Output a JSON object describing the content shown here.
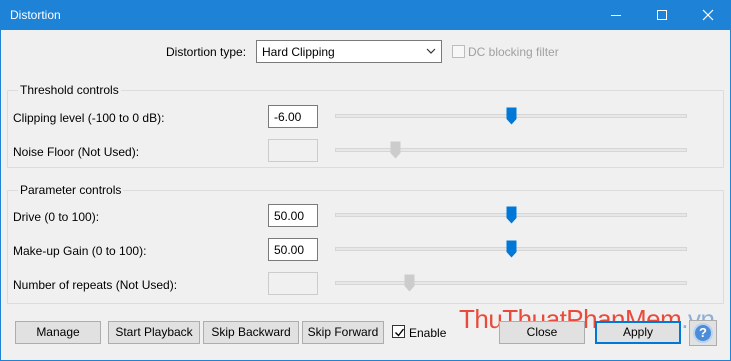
{
  "window": {
    "title": "Distortion"
  },
  "distortion_type": {
    "label": "Distortion type:",
    "selected": "Hard Clipping",
    "dc_label": "DC blocking filter",
    "dc_checked": false,
    "dc_enabled": false
  },
  "threshold": {
    "title": "Threshold controls",
    "clipping": {
      "label": "Clipping level (-100 to 0 dB):",
      "value": "-6.00",
      "slider_fraction": 0.5,
      "enabled": true
    },
    "noise": {
      "label": "Noise Floor (Not Used):",
      "value": "",
      "slider_fraction": 0.17,
      "enabled": false
    }
  },
  "parameters": {
    "title": "Parameter controls",
    "drive": {
      "label": "Drive (0 to 100):",
      "value": "50.00",
      "slider_fraction": 0.5,
      "enabled": true
    },
    "makeup": {
      "label": "Make-up Gain (0 to 100):",
      "value": "50.00",
      "slider_fraction": 0.5,
      "enabled": true
    },
    "repeats": {
      "label": "Number of repeats (Not Used):",
      "value": "",
      "slider_fraction": 0.21,
      "enabled": false
    }
  },
  "buttons": {
    "manage": "Manage",
    "start_playback": "Start Playback",
    "skip_backward": "Skip Backward",
    "skip_forward": "Skip Forward",
    "enable_label": "Enable",
    "enable_checked": true,
    "close": "Close",
    "apply": "Apply",
    "help": "?"
  },
  "watermark": {
    "part1": "ThuThuat",
    "part2": "PhanMem",
    "part3": ".vn"
  },
  "colors": {
    "titlebar": "#1e83d7",
    "thumb_active": "#0078d7",
    "thumb_disabled": "#cccccc",
    "default_button_border": "#0078d7"
  },
  "icons": {
    "minimize": "minimize-icon",
    "maximize": "maximize-icon",
    "close": "close-icon",
    "dropdown": "chevron-down-icon",
    "help": "help-icon"
  }
}
